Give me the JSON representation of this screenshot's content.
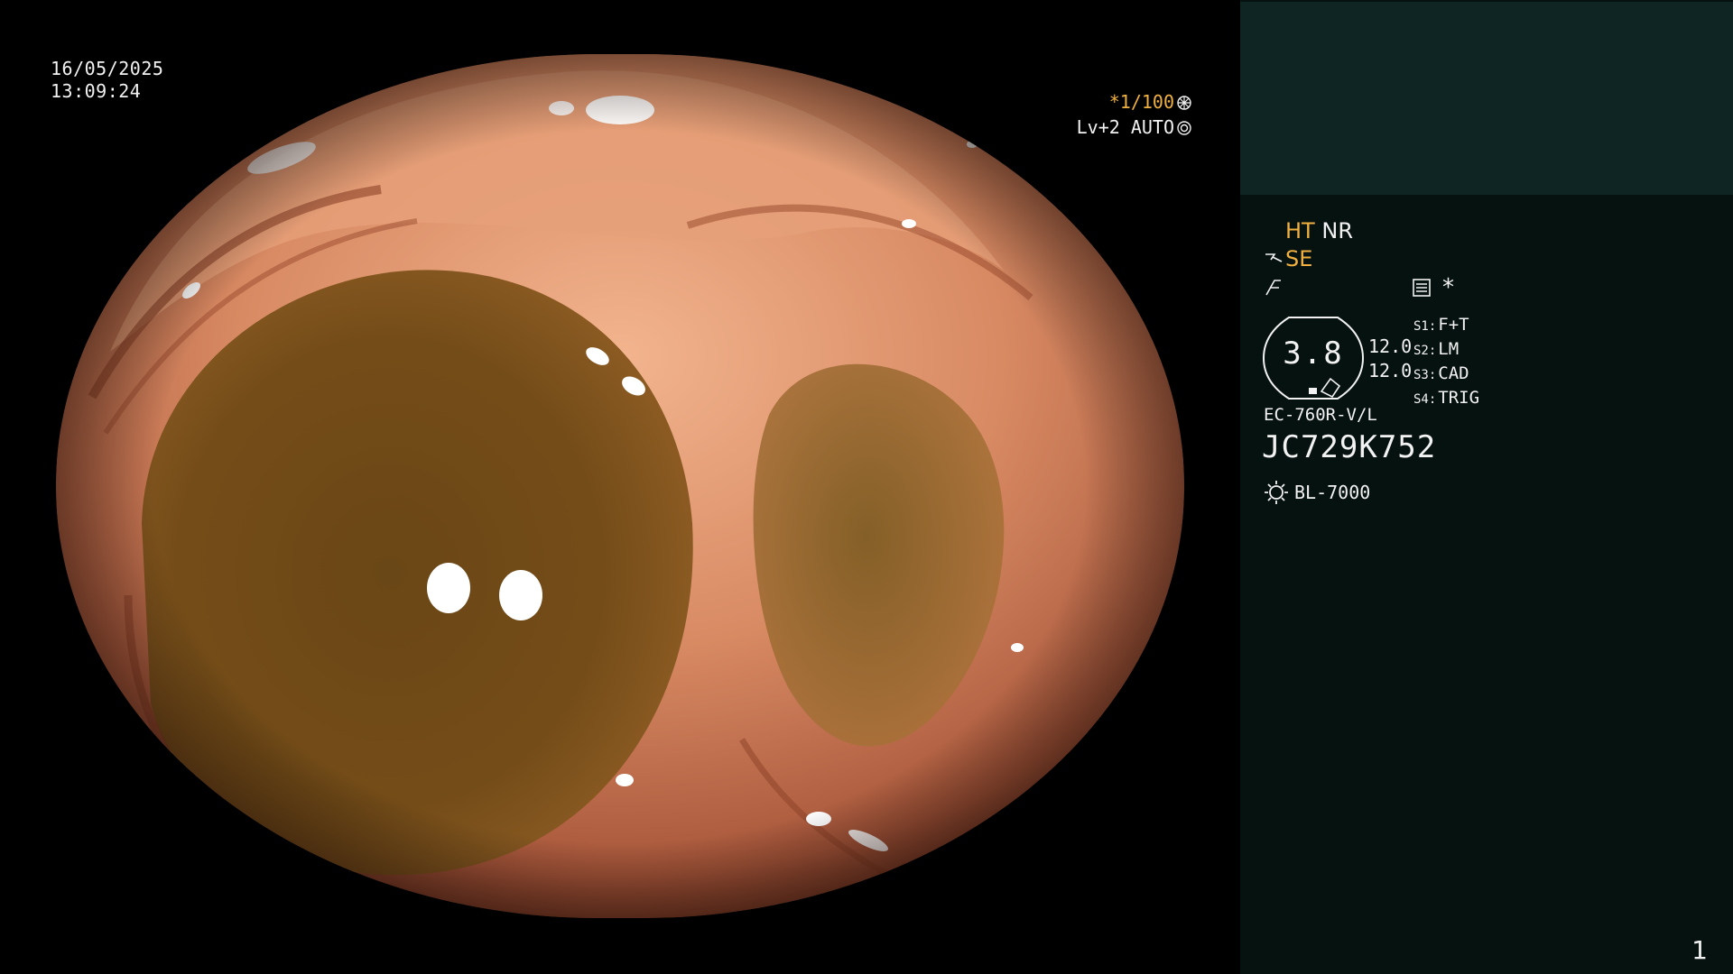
{
  "overlay": {
    "date": "16/05/2025",
    "time": "13:09:24",
    "shutter": "*1/100",
    "level": "Lv+2 AUTO"
  },
  "side_panel": {
    "mode_ht": "HT",
    "mode_nr": "NR",
    "mode_se": "SE",
    "memo_mark": "*",
    "scope_value": "3.8",
    "channel_1": "12.0",
    "channel_2": "12.0",
    "switches": [
      {
        "key": "S1:",
        "value": "F+T"
      },
      {
        "key": "S2:",
        "value": "LM"
      },
      {
        "key": "S3:",
        "value": "CAD"
      },
      {
        "key": "S4:",
        "value": "TRIG"
      }
    ],
    "scope_model": "EC-760R-V/L",
    "serial": "JC729K752",
    "light_source": "BL-7000"
  },
  "page_number": "1",
  "colors": {
    "background": "#000000",
    "panel": "#061210",
    "panel_header": "#0f2523",
    "accent_orange": "#f0b040",
    "text": "#f2f2f2"
  }
}
